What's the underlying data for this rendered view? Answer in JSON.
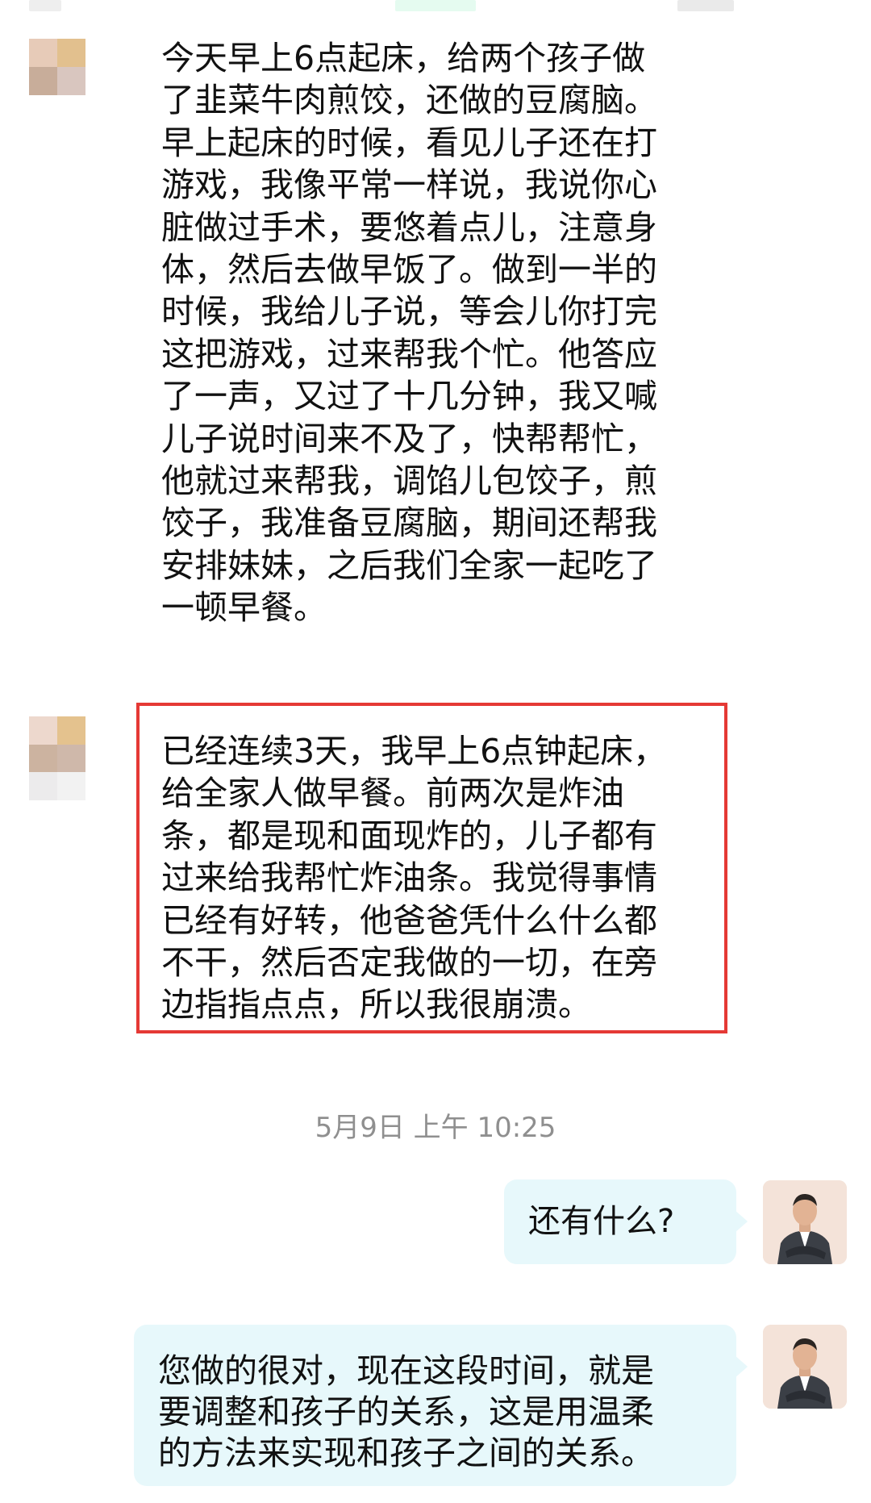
{
  "chat": {
    "incoming_1": {
      "text": "今天早上6点起床，给两个孩子做了韭菜牛肉煎饺，还做的豆腐脑。早上起床的时候，看见儿子还在打游戏，我像平常一样说，我说你心脏做过手术，要悠着点儿，注意身体，然后去做早饭了。做到一半的时候，我给儿子说，等会儿你打完这把游戏，过来帮我个忙。他答应了一声，又过了十几分钟，我又喊儿子说时间来不及了，快帮帮忙，他就过来帮我，调馅儿包饺子，煎饺子，我准备豆腐脑，期间还帮我安排妹妹，之后我们全家一起吃了一顿早餐。",
      "lines": [
        "今天早上6点起床，给两个孩子做",
        "了韭菜牛肉煎饺，还做的豆腐脑。",
        "早上起床的时候，看见儿子还在打",
        "游戏，我像平常一样说，我说你心",
        "脏做过手术，要悠着点儿，注意身",
        "体，然后去做早饭了。做到一半的",
        "时候，我给儿子说，等会儿你打完",
        "这把游戏，过来帮我个忙。他答应",
        "了一声，又过了十几分钟，我又喊",
        "儿子说时间来不及了，快帮帮忙，",
        "他就过来帮我，调馅儿包饺子，煎",
        "饺子，我准备豆腐脑，期间还帮我",
        "安排妹妹，之后我们全家一起吃了",
        "一顿早餐。"
      ]
    },
    "incoming_2": {
      "lines": [
        "已经连续3天，我早上6点钟起床，",
        "给全家人做早餐。前两次是炸油",
        "条，都是现和面现炸的，儿子都有",
        "过来给我帮忙炸油条。我觉得事情",
        "已经有好转，他爸爸凭什么什么都",
        "不干，然后否定我做的一切，在旁",
        "边指指点点，所以我很崩溃。"
      ]
    },
    "timestamp": "5月9日 上午 10:25",
    "outgoing_1": {
      "text": "还有什么?"
    },
    "outgoing_2": {
      "lines": [
        "您做的很对，现在这段时间，就是",
        "要调整和孩子的关系，这是用温柔",
        "的方法来实现和孩子之间的关系。"
      ]
    }
  },
  "colors": {
    "highlight_border": "#e53935",
    "outgoing_bubble": "#e7f8fb",
    "timestamp_text": "#8f8f8f"
  },
  "icons": {
    "incoming_avatar": "pixelated-avatar-icon",
    "agent_avatar": "agent-person-avatar-icon"
  }
}
